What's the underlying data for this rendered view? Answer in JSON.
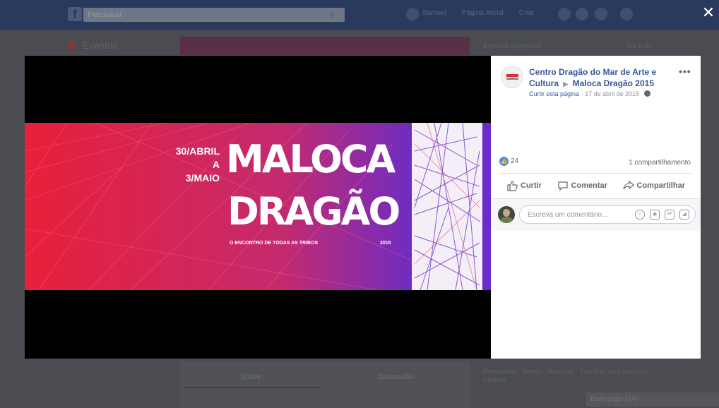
{
  "background_page": {
    "search_placeholder": "Pesquisar",
    "nav_items": [
      "Samuel",
      "Página inicial",
      "Criar"
    ],
    "left_title": "Eventos",
    "right_header": "Eventos sugeridos",
    "right_header_link": "Ver tudo",
    "tabs": [
      "Sobre",
      "Discussão"
    ],
    "bottom_right_text": "Privacidade · Termos · Anúncios · Escolhas para anúncios · Cookies",
    "chat_label": "Bate-papo (14)"
  },
  "viewer": {
    "close_label": "✕",
    "photo": {
      "dates_line1": "30/ABRIL",
      "dates_line2": "A",
      "dates_line3": "3/MAIO",
      "title_line1": "MALOCA",
      "title_line2": "DRAGÃO",
      "subtitle": "O ENCONTRO DE TODAS AS TRIBOS",
      "year": "2015"
    }
  },
  "post": {
    "page_name": "Centro Dragão do Mar de Arte e Cultura",
    "arrow": "▶",
    "event_name": "Maloca Dragão 2015",
    "like_page": "Curtir esta página",
    "separator": "·",
    "date": "17 de abril de 2015",
    "more": "•••",
    "reaction_count": "24",
    "shares": "1 compartilhamento",
    "actions": {
      "like": "Curtir",
      "comment": "Comentar",
      "share": "Compartilhar"
    },
    "comment_placeholder": "Escreva um comentário...",
    "gif_label": "GIF"
  },
  "colors": {
    "link": "#365899",
    "like_badge": "#4a8af4",
    "poster_red": "#e0243f",
    "poster_purple": "#6a2cc7"
  }
}
